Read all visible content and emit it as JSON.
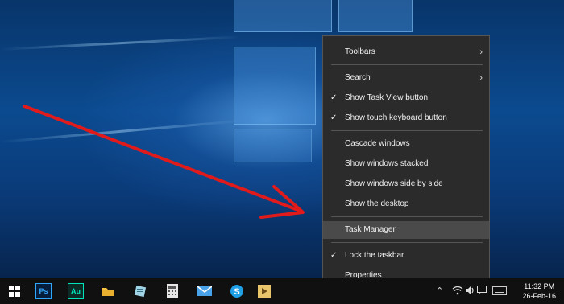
{
  "context_menu": {
    "toolbars": "Toolbars",
    "search": "Search",
    "show_task_view": "Show Task View button",
    "show_touch_keyboard": "Show touch keyboard button",
    "cascade": "Cascade windows",
    "stacked": "Show windows stacked",
    "side_by_side": "Show windows side by side",
    "show_desktop": "Show the desktop",
    "task_manager": "Task Manager",
    "lock_taskbar": "Lock the taskbar",
    "properties": "Properties",
    "check_glyph": "✓",
    "chevron_glyph": "›"
  },
  "taskbar": {
    "ps_label": "Ps",
    "au_label": "Au",
    "time": "11:32 PM",
    "date": "26-Feb-16"
  },
  "colors": {
    "arrow": "#e11b1b",
    "menu_bg": "#2b2b2b",
    "menu_highlight": "#4a4a4a",
    "taskbar_bg": "#101010"
  }
}
